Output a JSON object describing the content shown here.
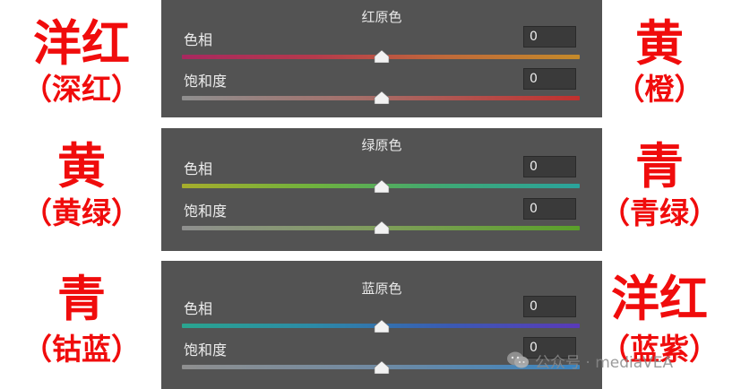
{
  "panels": [
    {
      "title": "红原色",
      "hue_label": "色相",
      "hue_value": "0",
      "saturation_label": "饱和度",
      "saturation_value": "0",
      "left_big": "洋红",
      "left_small": "（深红）",
      "right_big": "黄",
      "right_small": "（橙）",
      "hue_gradient": [
        "#a8285f",
        "#b53a4c",
        "#c06a3a",
        "#c48a2a"
      ],
      "sat_gradient": [
        "#8f8f8f",
        "#a86a64",
        "#c0302e"
      ]
    },
    {
      "title": "绿原色",
      "hue_label": "色相",
      "hue_value": "0",
      "saturation_label": "饱和度",
      "saturation_value": "0",
      "left_big": "黄",
      "left_small": "（黄绿）",
      "right_big": "青",
      "right_small": "（青绿）",
      "hue_gradient": [
        "#a6ad2c",
        "#6fb23e",
        "#3ea876",
        "#2aa39c"
      ],
      "sat_gradient": [
        "#8f8f8f",
        "#7f9e5a",
        "#5aa02a"
      ]
    },
    {
      "title": "蓝原色",
      "hue_label": "色相",
      "hue_value": "0",
      "saturation_label": "饱和度",
      "saturation_value": "0",
      "left_big": "青",
      "left_small": "（钴蓝）",
      "right_big": "洋红",
      "right_small": "（蓝紫）",
      "hue_gradient": [
        "#2aa58f",
        "#2c8aa7",
        "#3a5bb3",
        "#5a3ab8"
      ],
      "sat_gradient": [
        "#8f8f8f",
        "#6f8aa3",
        "#3a84c0"
      ]
    }
  ],
  "watermark": {
    "text": "公众号 · mediaVEA"
  },
  "colors": {
    "annotation_red": "#f00c0c",
    "panel_bg": "#535353",
    "field_bg": "#3a3a3a"
  }
}
